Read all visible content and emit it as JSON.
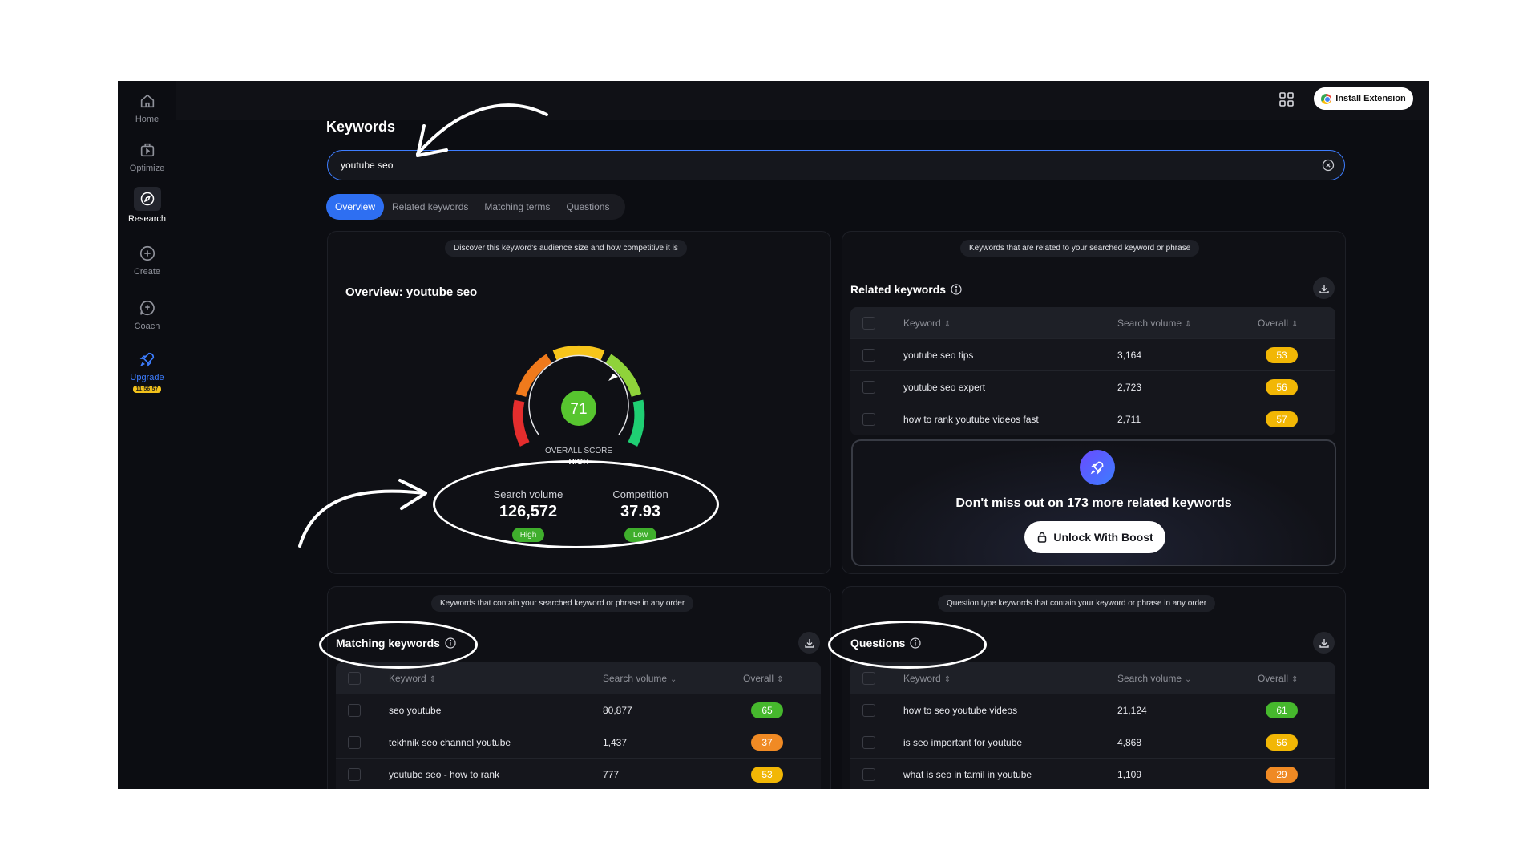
{
  "sidebar": {
    "items": [
      {
        "label": "Home",
        "icon": "home-icon"
      },
      {
        "label": "Optimize",
        "icon": "optimize-icon"
      },
      {
        "label": "Research",
        "icon": "compass-icon"
      },
      {
        "label": "Create",
        "icon": "plus-circle-icon"
      },
      {
        "label": "Coach",
        "icon": "chat-icon"
      },
      {
        "label": "Upgrade",
        "icon": "rocket-icon"
      }
    ],
    "timer": "11:56:57"
  },
  "header": {
    "install_label": "Install Extension"
  },
  "page": {
    "title": "Keywords",
    "search_value": "youtube seo"
  },
  "tabs": [
    "Overview",
    "Related keywords",
    "Matching terms",
    "Questions"
  ],
  "overview": {
    "hint": "Discover this keyword's audience size and how competitive it is",
    "title": "Overview: youtube seo",
    "score": "71",
    "score_value": 71,
    "score_label": "OVERALL SCORE",
    "score_level": "HIGH",
    "search_volume_label": "Search volume",
    "search_volume": "126,572",
    "search_volume_level": "High",
    "competition_label": "Competition",
    "competition": "37.93",
    "competition_level": "Low"
  },
  "related": {
    "hint": "Keywords that are related to your searched keyword or phrase",
    "title": "Related keywords",
    "columns": {
      "keyword": "Keyword",
      "volume": "Search volume",
      "overall": "Overall"
    },
    "rows": [
      {
        "keyword": "youtube seo tips",
        "volume": "3,164",
        "overall": "53",
        "color": "#f2b705"
      },
      {
        "keyword": "youtube seo expert",
        "volume": "2,723",
        "overall": "56",
        "color": "#f2b705"
      },
      {
        "keyword": "how to rank youtube videos fast",
        "volume": "2,711",
        "overall": "57",
        "color": "#f2b705"
      }
    ],
    "promo_text": "Don't miss out on 173 more related keywords",
    "unlock_label": "Unlock With Boost"
  },
  "matching": {
    "hint": "Keywords that contain your searched keyword or phrase in any order",
    "title": "Matching keywords",
    "columns": {
      "keyword": "Keyword",
      "volume": "Search volume",
      "overall": "Overall"
    },
    "rows": [
      {
        "keyword": "seo youtube",
        "volume": "80,877",
        "overall": "65",
        "color": "#46b82d"
      },
      {
        "keyword": "tekhnik seo channel youtube",
        "volume": "1,437",
        "overall": "37",
        "color": "#f08a24"
      },
      {
        "keyword": "youtube seo - how to rank",
        "volume": "777",
        "overall": "53",
        "color": "#f2b705"
      }
    ]
  },
  "questions": {
    "hint": "Question type keywords that contain your keyword or phrase in any order",
    "title": "Questions",
    "columns": {
      "keyword": "Keyword",
      "volume": "Search volume",
      "overall": "Overall"
    },
    "rows": [
      {
        "keyword": "how to seo youtube videos",
        "volume": "21,124",
        "overall": "61",
        "color": "#46b82d"
      },
      {
        "keyword": "is seo important for youtube",
        "volume": "4,868",
        "overall": "56",
        "color": "#f2b705"
      },
      {
        "keyword": "what is seo in tamil in youtube",
        "volume": "1,109",
        "overall": "29",
        "color": "#f08a24"
      }
    ]
  }
}
